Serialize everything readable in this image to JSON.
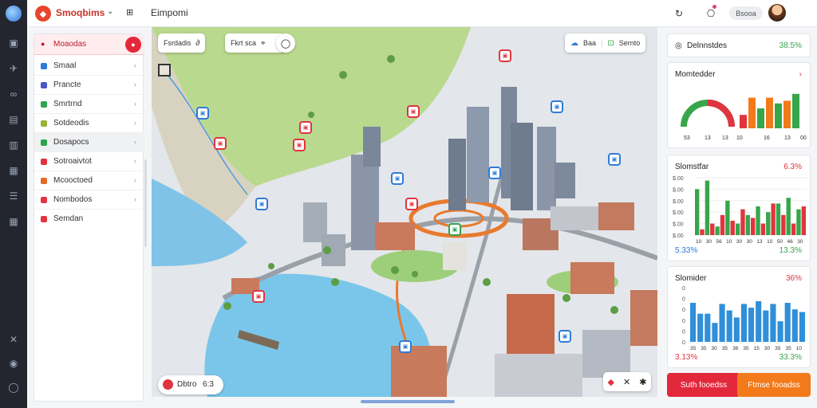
{
  "topbar": {
    "brand_name": "Smoqbims",
    "page_title": "Eimpomi",
    "pill_label": "Bsooa"
  },
  "sidebar": {
    "header_label": "Moaodas",
    "items": [
      {
        "label": "Smaal",
        "color": "#2f7bd9"
      },
      {
        "label": "Prancte",
        "color": "#4b55c4"
      },
      {
        "label": "Smrtrnd",
        "color": "#2ea44f"
      },
      {
        "label": "Sotdeodis",
        "color": "#9ab23a"
      },
      {
        "label": "Dosapocs",
        "color": "#2ea44f"
      },
      {
        "label": "Sotroaivtot",
        "color": "#e0353f"
      },
      {
        "label": "Mcooctoed",
        "color": "#e26b2a"
      },
      {
        "label": "Nombodos",
        "color": "#e0353f"
      },
      {
        "label": "Semdan",
        "color": "#e0353f"
      }
    ]
  },
  "map": {
    "tool_left_label": "Fsrdadis",
    "tool_mid_label": "Fkrt sca",
    "tool_right_a": "Baa",
    "tool_right_b": "Sernto",
    "footer_a": "Dbtro",
    "footer_b": "6:3"
  },
  "cards": {
    "summary": {
      "title": "Delnnstdes",
      "value": "38.5%"
    },
    "gauge": {
      "title": "Momtedder",
      "chart_data": {
        "type": "bar",
        "categories": [
          "53",
          "13",
          "13",
          "10",
          "16",
          "13",
          "00"
        ],
        "values": [
          35,
          80,
          52,
          80,
          65,
          72,
          90
        ]
      }
    },
    "bars1": {
      "title": "Slomstfar",
      "value": "6.3%",
      "foot_left": "5.33%",
      "foot_right": "13.3%",
      "chart_data": {
        "type": "bar",
        "ylabels": [
          "$.00",
          "$.00",
          "$.00",
          "$.00",
          "$.00",
          "$.00"
        ],
        "categories": [
          "10",
          "30",
          "56",
          "10",
          "30",
          "30",
          "13",
          "10",
          "50",
          "46",
          "30"
        ],
        "series": [
          {
            "color": "#37a64a",
            "values": [
              80,
              95,
              15,
              60,
              20,
              35,
              50,
              40,
              55,
              65,
              45
            ]
          },
          {
            "color": "#e0353f",
            "values": [
              10,
              20,
              35,
              25,
              45,
              30,
              20,
              55,
              35,
              20,
              50
            ]
          }
        ]
      }
    },
    "bars2": {
      "title": "Slomider",
      "value": "36%",
      "foot_left": "3.13%",
      "foot_right": "33.3%",
      "chart_data": {
        "type": "bar",
        "ylabels": [
          "0",
          "0",
          "0",
          "0",
          "0",
          "0"
        ],
        "categories": [
          "35",
          "35",
          "30",
          "35",
          "36",
          "35",
          "15",
          "30",
          "35",
          "35",
          "10"
        ],
        "values": [
          72,
          52,
          52,
          35,
          70,
          58,
          45,
          70,
          63,
          75,
          58,
          70,
          38,
          72,
          60,
          55
        ]
      }
    },
    "btn_left": "Suth fooedss",
    "btn_right": "Ftmse fooadss"
  },
  "colors": {
    "accent": "#e3283b",
    "brand": "#e8452c",
    "blue": "#2f7bd9",
    "green": "#37a64a",
    "orange": "#f27a1a"
  }
}
